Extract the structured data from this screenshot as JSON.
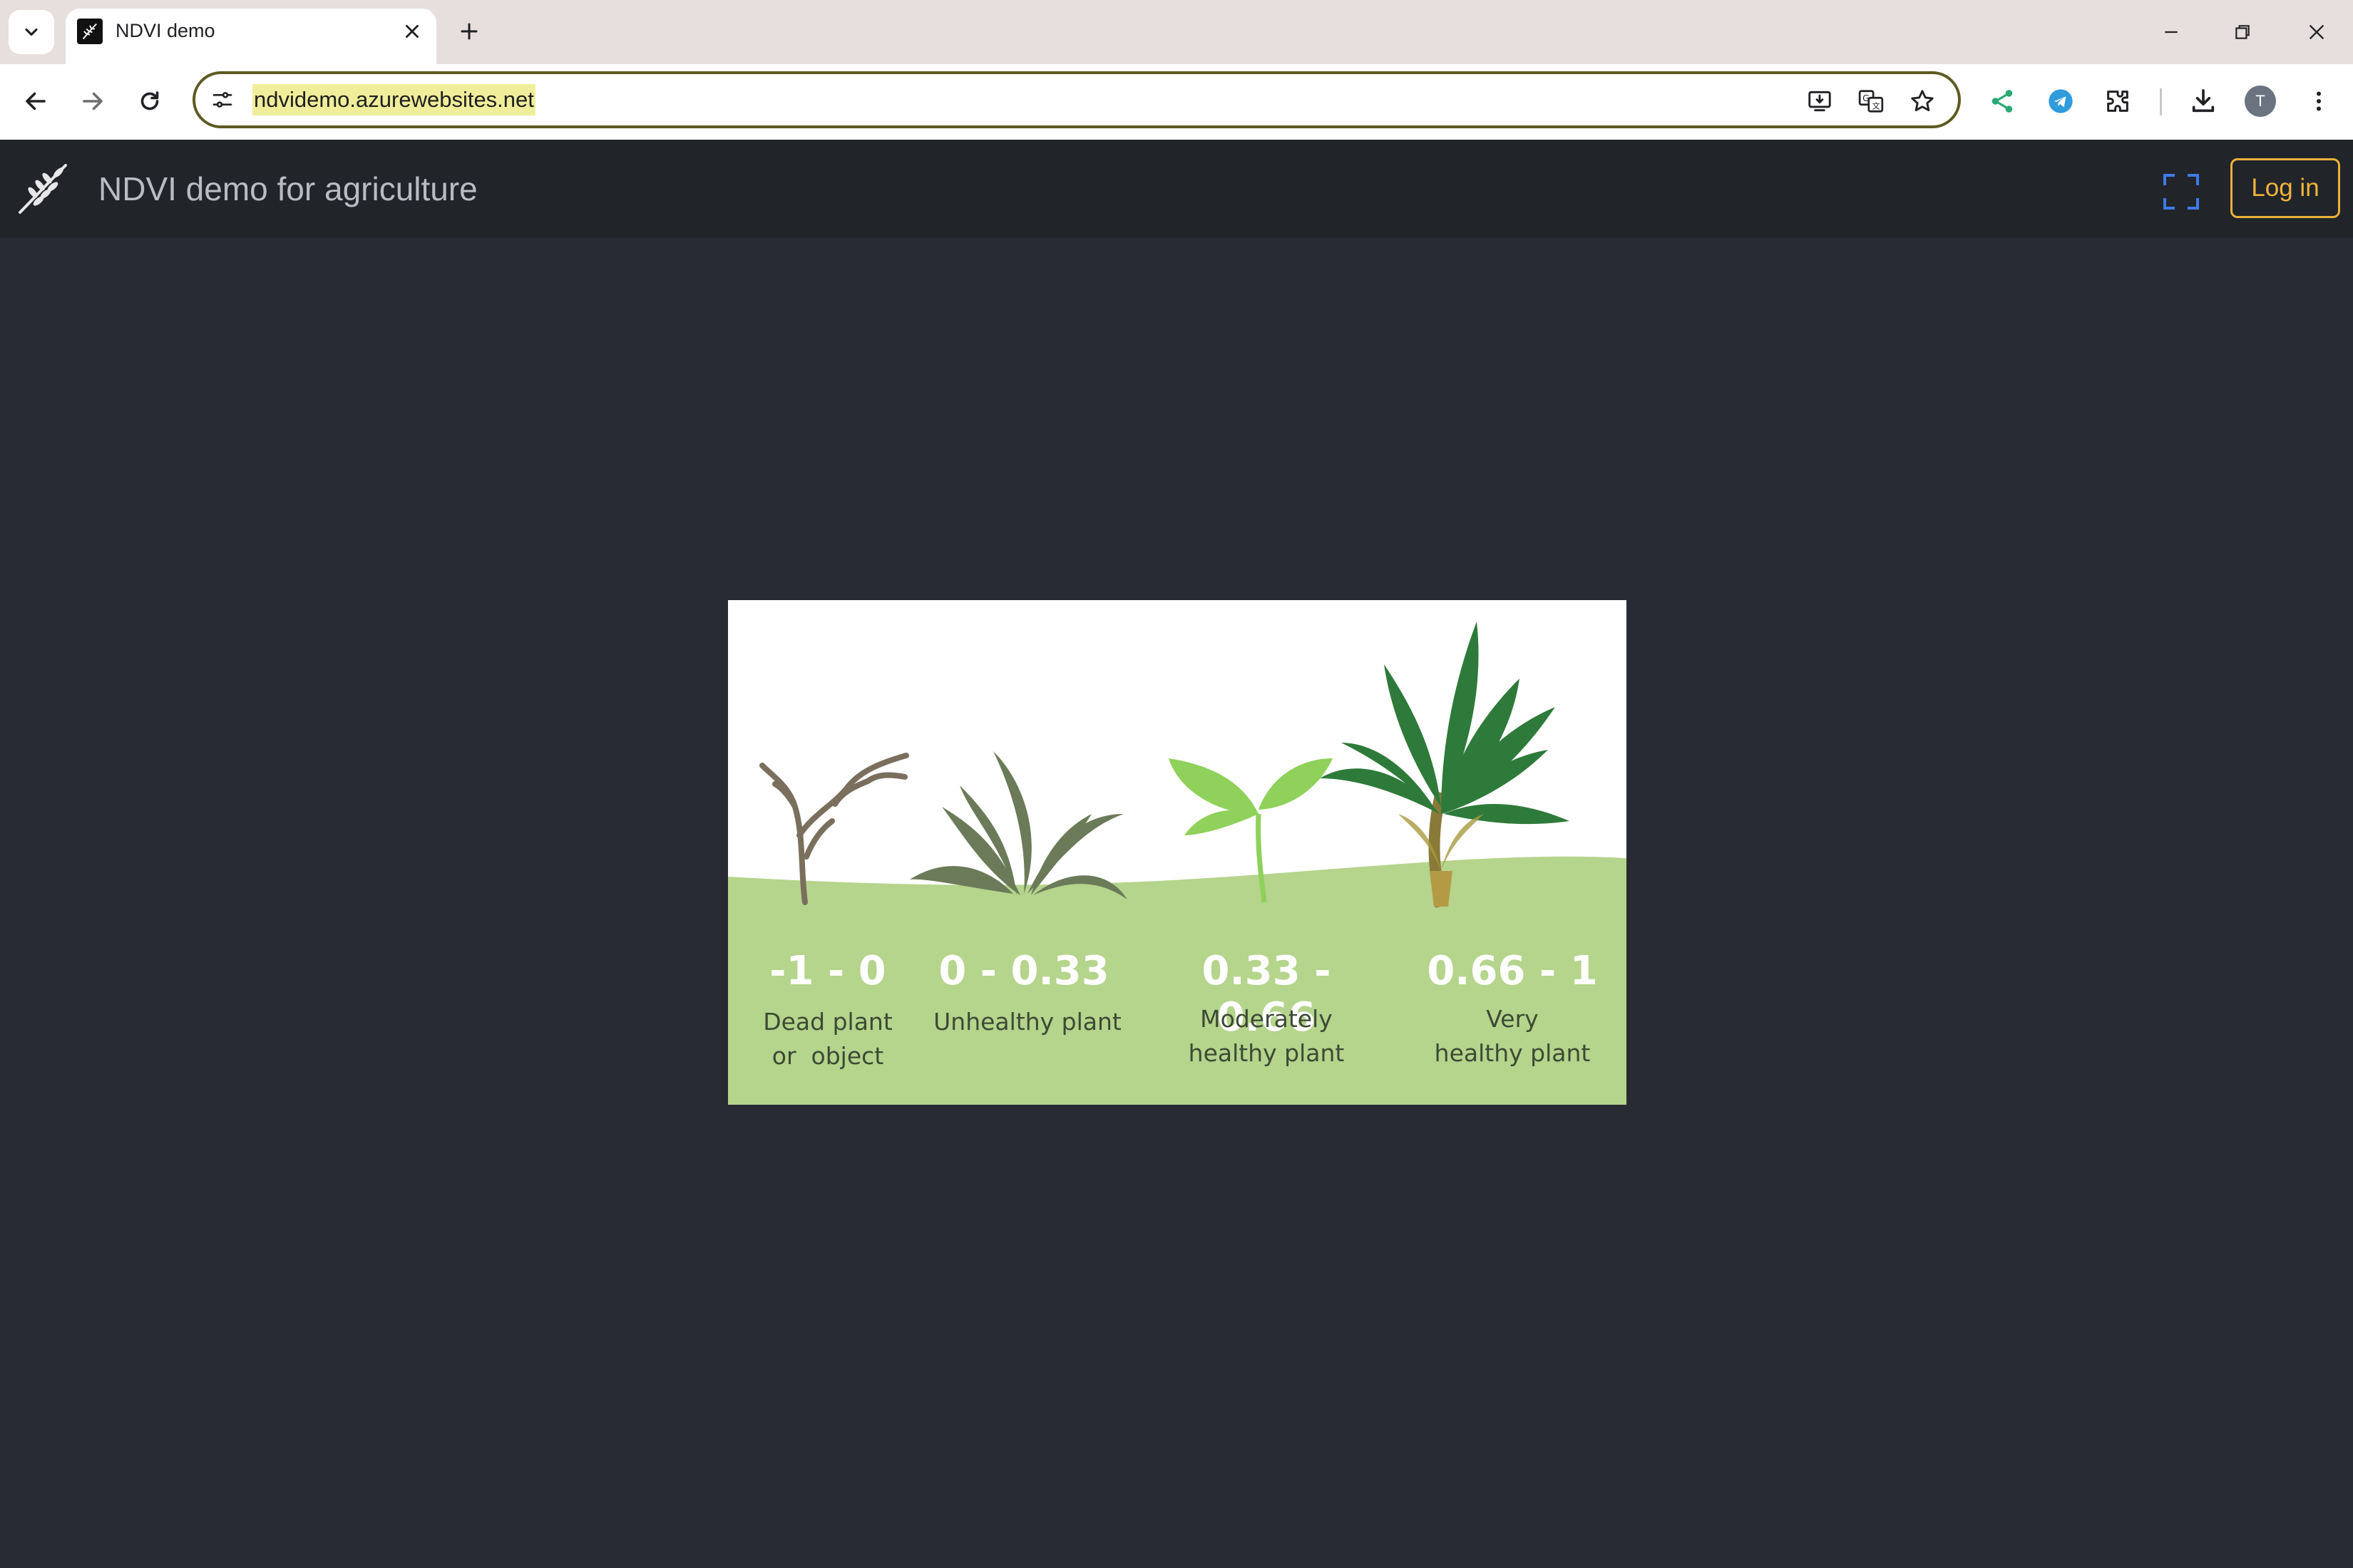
{
  "browser": {
    "tab_title": "NDVI demo",
    "url": "ndvidemo.azurewebsites.net",
    "profile_initial": "T"
  },
  "app": {
    "title": "NDVI demo for agriculture",
    "login_label": "Log in"
  },
  "ndvi_legend": [
    {
      "range": "-1 - 0",
      "desc_line1": "Dead plant",
      "desc_line2": "or  object"
    },
    {
      "range": "0 - 0.33",
      "desc_line1": "Unhealthy plant",
      "desc_line2": ""
    },
    {
      "range": "0.33 - 0.66",
      "desc_line1": "Moderately",
      "desc_line2": "healthy plant"
    },
    {
      "range": "0.66 - 1",
      "desc_line1": "Very",
      "desc_line2": "healthy plant"
    }
  ],
  "colors": {
    "page_bg": "#282b33",
    "header_bg": "#212429",
    "login_accent": "#f0b43c",
    "fullscreen_icon": "#3f7be8",
    "ground_green": "#b5d48c"
  },
  "icons": [
    "tab-search-icon",
    "close-icon",
    "plus-icon",
    "minimize-icon",
    "restore-icon",
    "back-icon",
    "forward-icon",
    "reload-icon",
    "site-settings-icon",
    "install-icon",
    "translate-icon",
    "star-icon",
    "share-icon",
    "telegram-icon",
    "extensions-icon",
    "download-icon",
    "more-icon",
    "wheat-logo-icon",
    "fullscreen-icon"
  ]
}
